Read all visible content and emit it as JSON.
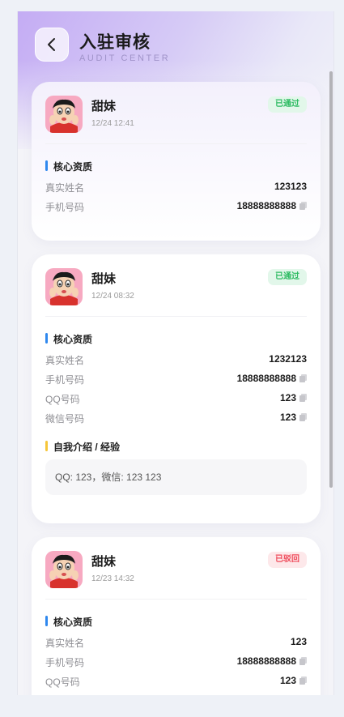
{
  "header": {
    "title": "入驻审核",
    "subtitle": "AUDIT CENTER"
  },
  "colors": {
    "accent_blue": "#2f88ee",
    "accent_yellow": "#f6c63a",
    "approved": "#2dbb62",
    "rejected": "#ef4b5b"
  },
  "cards": [
    {
      "name": "甜妹",
      "time": "12/24 12:41",
      "status": "已通过",
      "qual_title": "核心资质",
      "rows": [
        {
          "label": "真实姓名",
          "value": "123123"
        },
        {
          "label": "手机号码",
          "value": "18888888888"
        }
      ]
    },
    {
      "name": "甜妹",
      "time": "12/24 08:32",
      "status": "已通过",
      "qual_title": "核心资质",
      "rows": [
        {
          "label": "真实姓名",
          "value": "1232123"
        },
        {
          "label": "手机号码",
          "value": "18888888888"
        },
        {
          "label": "QQ号码",
          "value": "123"
        },
        {
          "label": "微信号码",
          "value": "123"
        }
      ],
      "intro_title": "自我介绍 / 经验",
      "intro_text": "QQ: 123，微信: 123 123"
    },
    {
      "name": "甜妹",
      "time": "12/23 14:32",
      "status": "已驳回",
      "qual_title": "核心资质",
      "rows": [
        {
          "label": "真实姓名",
          "value": "123"
        },
        {
          "label": "手机号码",
          "value": "18888888888"
        },
        {
          "label": "QQ号码",
          "value": "123"
        }
      ]
    }
  ]
}
